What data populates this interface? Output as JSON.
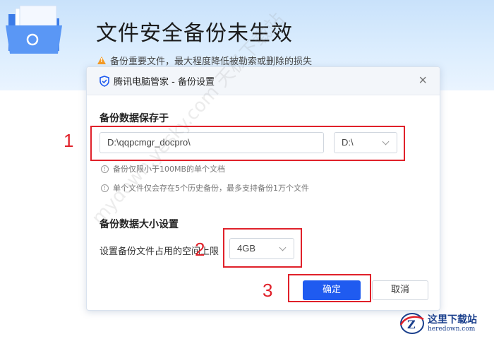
{
  "hero": {
    "title": "文件安全备份未生效",
    "warning": "备份重要文件，最大程度降低被勒索或删除的损失"
  },
  "dialog": {
    "title": "腾讯电脑管家 - 备份设置",
    "close_icon": "×",
    "save_section": {
      "title": "备份数据保存于",
      "path_value": "D:\\qqpcmgr_docpro\\",
      "drive_value": "D:\\",
      "note1": "备份仅限小于100MB的单个文档",
      "note2": "单个文件仅会存在5个历史备份，最多支持备份1万个文件"
    },
    "size_section": {
      "title": "备份数据大小设置",
      "label": "设置备份文件占用的空间上限",
      "size_value": "4GB"
    },
    "ok_label": "确定",
    "cancel_label": "取消"
  },
  "annotations": {
    "step1": "1",
    "step2": "2",
    "step3": "3",
    "color": "#e0212a"
  },
  "watermark": "mydown.yesky.com 天极下载站",
  "logo": {
    "main": "这里下载站",
    "sub": "heredown.com"
  },
  "colors": {
    "primary_button": "#1f5bf0",
    "hero_bg": "#d4e8fc"
  }
}
